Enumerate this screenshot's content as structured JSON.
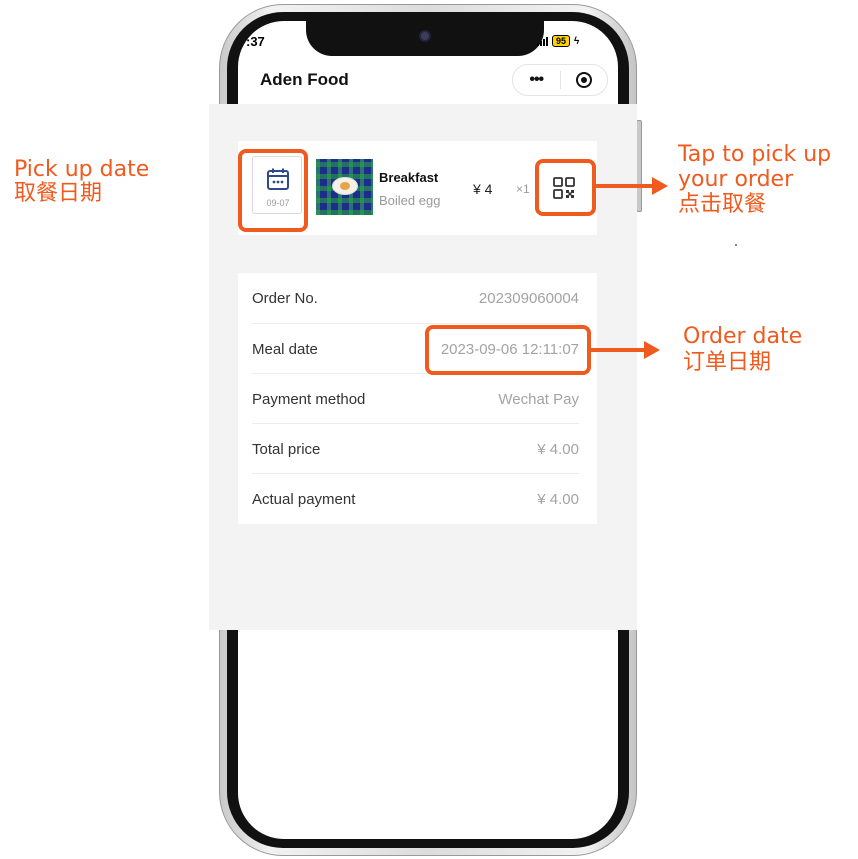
{
  "status_bar": {
    "time": ":37",
    "battery": "95"
  },
  "header": {
    "title": "Aden Food",
    "more_label": "•••"
  },
  "order_item": {
    "pickup_date": "09-07",
    "name": "Breakfast",
    "description": "Boiled egg",
    "price": "¥ 4",
    "quantity": "×1"
  },
  "details": [
    {
      "label": "Order No.",
      "value": "202309060004"
    },
    {
      "label": "Meal date",
      "value": "2023-09-06 12:11:07"
    },
    {
      "label": "Payment method",
      "value": "Wechat Pay"
    },
    {
      "label": "Total price",
      "value": "¥ 4.00"
    },
    {
      "label": "Actual payment",
      "value": "¥ 4.00"
    }
  ],
  "annotations": {
    "pickup": {
      "line1": "Pick up date",
      "line2": "取餐日期"
    },
    "tap": {
      "line1": "Tap to pick up",
      "line2": "your order",
      "line3": "点击取餐"
    },
    "order_date": {
      "line1": "Order date",
      "line2": "订单日期"
    }
  },
  "colors": {
    "annotation": "#f05a1e",
    "background": "#f3f3f3",
    "muted_text": "#a3a3a3"
  },
  "icons": [
    "calendar-icon",
    "qr-code-icon",
    "more-icon",
    "target-icon",
    "signal-icon",
    "battery-icon"
  ]
}
